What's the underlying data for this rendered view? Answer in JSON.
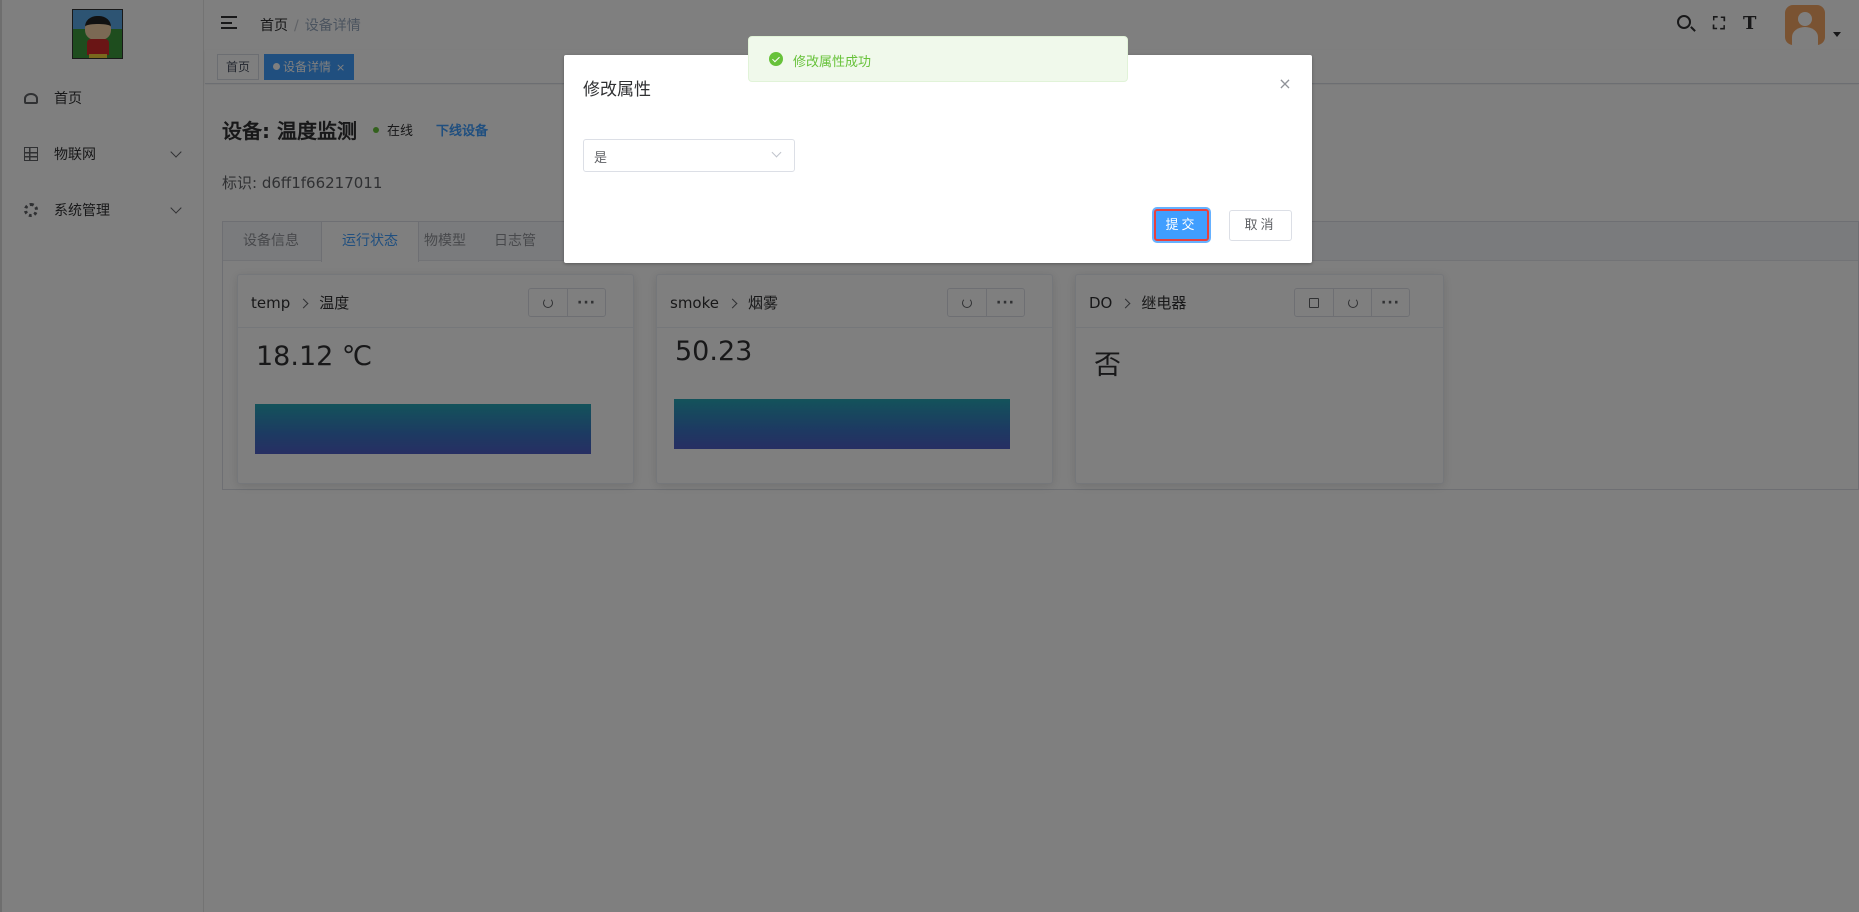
{
  "sidebar": {
    "items": [
      {
        "label": "首页",
        "icon": "dashboard-icon"
      },
      {
        "label": "物联网",
        "icon": "grid-icon"
      },
      {
        "label": "系统管理",
        "icon": "gear-icon"
      }
    ]
  },
  "header": {
    "breadcrumb": [
      "首页",
      "设备详情"
    ],
    "icons": [
      "search-icon",
      "fullscreen-icon",
      "font-size-icon"
    ],
    "fullscreen_glyph": "⛶",
    "font_glyph": "T"
  },
  "tags": [
    {
      "label": "首页"
    },
    {
      "label": "设备详情",
      "close": "×"
    }
  ],
  "device": {
    "title": "设备: 温度监测",
    "status": "在线",
    "offline_link": "下线设备",
    "ident": "标识: d6ff1f66217011"
  },
  "tabs": [
    "设备信息",
    "运行状态",
    "物模型",
    "日志管"
  ],
  "cards": [
    {
      "id": "temp",
      "name": "温度",
      "value": "18.12 ℃"
    },
    {
      "id": "smoke",
      "name": "烟雾",
      "value": "50.23"
    },
    {
      "id": "DO",
      "name": "继电器",
      "value": "否"
    }
  ],
  "dialog": {
    "title": "修改属性",
    "select_value": "是",
    "submit": "提交",
    "cancel": "取消",
    "close": "×"
  },
  "toast": {
    "message": "修改属性成功"
  },
  "colors": {
    "primary": "#409eff",
    "success": "#67c23a",
    "highlight": "#e8403e"
  }
}
